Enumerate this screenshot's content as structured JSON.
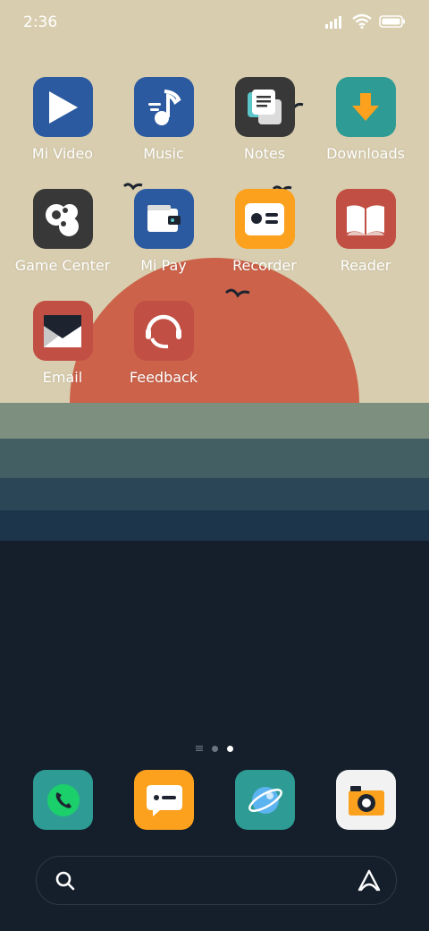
{
  "status": {
    "time": "2:36"
  },
  "apps": [
    {
      "label": "Mi Video"
    },
    {
      "label": "Music"
    },
    {
      "label": "Notes"
    },
    {
      "label": "Downloads"
    },
    {
      "label": "Game Center"
    },
    {
      "label": "Mi Pay"
    },
    {
      "label": "Recorder"
    },
    {
      "label": "Reader"
    },
    {
      "label": "Email"
    },
    {
      "label": "Feedback"
    }
  ],
  "pager": {
    "current_page": 3,
    "pages": 3
  },
  "dock": [
    {
      "icon": "phone-icon"
    },
    {
      "icon": "messages-icon"
    },
    {
      "icon": "browser-icon"
    },
    {
      "icon": "camera-icon"
    }
  ],
  "colors": {
    "sky": "#d8cdae",
    "sun": "#cc624a",
    "sea_dark": "#141f2b",
    "accent_blue": "#2c5aa0",
    "accent_teal": "#2e9c94",
    "accent_orange": "#fba11d",
    "accent_red": "#c14f44"
  }
}
